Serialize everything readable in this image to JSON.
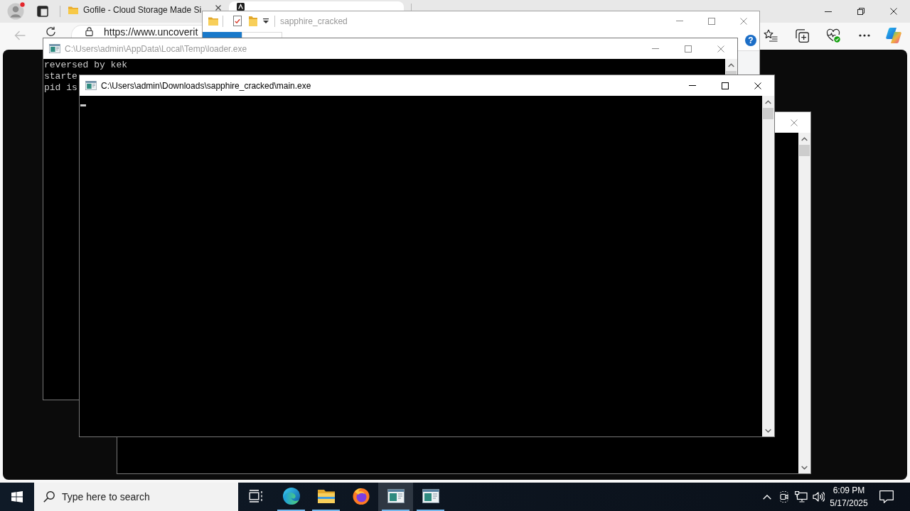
{
  "browser": {
    "tabs": [
      {
        "title": "Gofile - Cloud Storage Made Si",
        "selected": false
      },
      {
        "selected": true
      }
    ],
    "back_disabled": true,
    "address": "https://www.uncoverit"
  },
  "windows": [
    {
      "kind": "console",
      "active": false
    },
    {
      "kind": "explorer",
      "title": "sapphire_cracked",
      "active": false,
      "help_label": "?"
    },
    {
      "kind": "console",
      "title": "C:\\Users\\admin\\AppData\\Local\\Temp\\loader.exe",
      "active": false,
      "lines": [
        "reversed by kek",
        "starte",
        "pid is"
      ]
    },
    {
      "kind": "console",
      "title": "C:\\Users\\admin\\Downloads\\sapphire_cracked\\main.exe",
      "active": true,
      "cursor": true
    }
  ],
  "taskbar": {
    "search": {
      "placeholder": "Type here to search"
    },
    "apps": [
      {
        "kind": "task-view",
        "running": false,
        "selected": false
      },
      {
        "kind": "edge",
        "running": true,
        "selected": false
      },
      {
        "kind": "explorer",
        "running": true,
        "selected": false
      },
      {
        "kind": "firefox",
        "running": false,
        "selected": false
      },
      {
        "kind": "console",
        "running": true,
        "selected": true
      },
      {
        "kind": "console",
        "running": true,
        "selected": false
      }
    ],
    "clock": {
      "time": "6:09 PM",
      "date": "5/17/2025"
    }
  }
}
